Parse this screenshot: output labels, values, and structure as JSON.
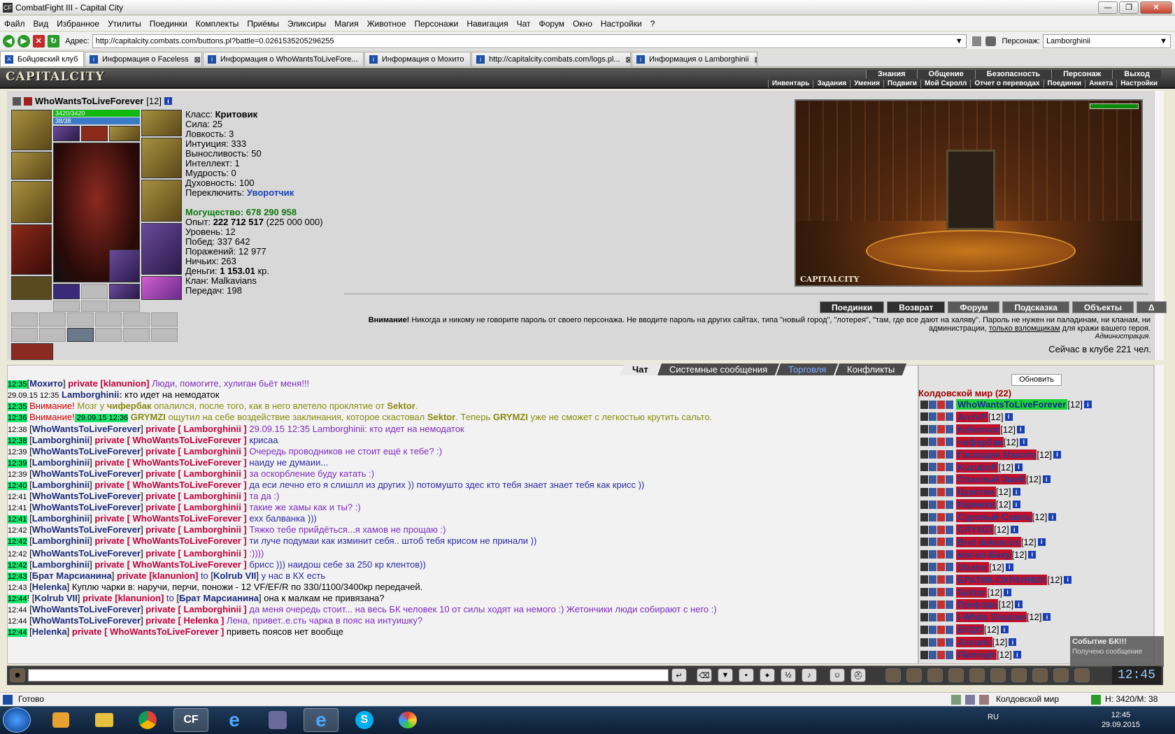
{
  "window": {
    "title": "CombatFight III - Capital City"
  },
  "menu": [
    "Файл",
    "Вид",
    "Избранное",
    "Утилиты",
    "Поединки",
    "Комплекты",
    "Приёмы",
    "Эликсиры",
    "Магия",
    "Животное",
    "Персонажи",
    "Навигация",
    "Чат",
    "Форум",
    "Окно",
    "Настройки",
    "?"
  ],
  "address": {
    "label": "Адрес:",
    "url": "http://capitalcity.combats.com/buttons.pl?battle=0.0261535205296255",
    "char_label": "Персонаж:",
    "char_value": "Lamborghinii"
  },
  "tabs": [
    {
      "label": "Бойцовский клуб"
    },
    {
      "label": "Информация о Faceless"
    },
    {
      "label": "Информация о WhoWantsToLiveFore..."
    },
    {
      "label": "Информация о Мохито"
    },
    {
      "label": "http://capitalcity.combats.com/logs.pl..."
    },
    {
      "label": "Информация о Lamborghinii"
    }
  ],
  "game": {
    "logo": "CAPITALCITY",
    "topnav": [
      "Знания",
      "Общение",
      "Безопасность",
      "Персонаж",
      "Выход"
    ],
    "subnav": [
      "Инвентарь",
      "Задания",
      "Умения",
      "Подвиги",
      "Мой Скролл",
      "Отчет о переводах",
      "Поединки",
      "Анкета",
      "Настройки"
    ]
  },
  "character": {
    "name": "WhoWantsToLiveForever",
    "level": "[12]",
    "hp": "3420/3420",
    "mana": "38/38",
    "class_label": "Класс:",
    "class_value": "Критовик",
    "stats": [
      "Сила: 25",
      "Ловкость: 3",
      "Интуиция: 333",
      "Выносливость: 50",
      "Интеллект: 1",
      "Мудрость: 0",
      "Духовность: 100"
    ],
    "switch_label": "Переключить:",
    "switch_value": "Уворотчик",
    "power_label": "Могущество:",
    "power_value": "678 290 958",
    "exp_label": "Опыт:",
    "exp_value": "222 712 517",
    "exp_next": "(225 000 000)",
    "level_line": "Уровень: 12",
    "wins": "Побед: 337 642",
    "losses": "Поражений: 12 977",
    "draws": "Ничьих: 263",
    "money_label": "Деньги:",
    "money_value": "1 153.01",
    "money_unit": "кр.",
    "clan": "Клан: Malkavians",
    "transfers": "Передач: 198"
  },
  "scene": {
    "caption": "CAPITALCITY"
  },
  "actions": [
    "Поединки",
    "Возврат",
    "Форум",
    "Подсказка",
    "Объекты",
    "Δ"
  ],
  "warning": {
    "bold": "Внимание!",
    "text": "Никогда и никому не говорите пароль от своего персонажа. Не вводите пароль на других сайтах, типа \"новый город\", \"лотерея\", \"там, где все дают на халяву\". Пароль не нужен ни паладинам, ни кланам, ни администрации,",
    "link": "только взломщикам",
    "tail": "для кражи вашего героя.",
    "sign": "Администрация."
  },
  "online": "Сейчас в клубе 221 чел.",
  "chat_tabs": [
    "Чат",
    "Системные сообщения",
    "Торговля",
    "Конфликты"
  ],
  "chat": [
    {
      "t": "12:35",
      "hl": true,
      "parts": [
        [
          "bk",
          "["
        ],
        [
          "nm",
          "Мохито"
        ],
        [
          "bk",
          "] "
        ],
        [
          "pv",
          "private [klanunion]"
        ],
        [
          "pm",
          " Люди, помогите, хулиган бьёт меня!!!"
        ]
      ]
    },
    {
      "t": "29.09.15 12:35",
      "hl": false,
      "parts": [
        [
          "nm",
          " Lamborghinii:"
        ],
        [
          "bk",
          " кто идет на немодаток"
        ]
      ]
    },
    {
      "t": "12:35",
      "hl": true,
      "parts": [
        [
          "warn",
          " Внимание!"
        ],
        [
          "sys",
          " Мозг у "
        ],
        [
          "sysb",
          "чифербак"
        ],
        [
          "sys",
          " опалился, после того, как в него влетело проклятие от "
        ],
        [
          "sysb",
          "Sektor"
        ],
        [
          "sys",
          "."
        ]
      ]
    },
    {
      "t": "12:36",
      "hl": true,
      "parts": [
        [
          "warn",
          " Внимание!"
        ],
        [
          "tsb",
          " 29.09.15 12:36"
        ],
        [
          "sysb",
          " GRYMZI"
        ],
        [
          "sys",
          " ощутил на себе воздействие заклинания, которое скастовал "
        ],
        [
          "sysb",
          "Sektor"
        ],
        [
          "sys",
          ". Теперь "
        ],
        [
          "sysb",
          "GRYMZI"
        ],
        [
          "sys",
          " уже не сможет с легкостью крутить сальто."
        ]
      ]
    },
    {
      "t": "12:38",
      "hl": false,
      "parts": [
        [
          "bk",
          " ["
        ],
        [
          "nm",
          "WhoWantsToLiveForever"
        ],
        [
          "bk",
          "] "
        ],
        [
          "pv",
          "private [ Lamborghinii ]"
        ],
        [
          "pm",
          " 29.09.15 12:35 Lamborghinii: кто идет на немодаток"
        ]
      ]
    },
    {
      "t": "12:38",
      "hl": true,
      "parts": [
        [
          "bk",
          " ["
        ],
        [
          "nm",
          "Lamborghinii"
        ],
        [
          "bk",
          "] "
        ],
        [
          "pv",
          "private [ WhoWantsToLiveForever ]"
        ],
        [
          "pm2",
          " крисаа"
        ]
      ]
    },
    {
      "t": "12:39",
      "hl": false,
      "parts": [
        [
          "bk",
          " ["
        ],
        [
          "nm",
          "WhoWantsToLiveForever"
        ],
        [
          "bk",
          "] "
        ],
        [
          "pv",
          "private [ Lamborghinii ]"
        ],
        [
          "pm",
          " Очередь проводников не стоит ещё к тебе? :)"
        ]
      ]
    },
    {
      "t": "12:39",
      "hl": true,
      "parts": [
        [
          "bk",
          " ["
        ],
        [
          "nm",
          "Lamborghinii"
        ],
        [
          "bk",
          "] "
        ],
        [
          "pv",
          "private [ WhoWantsToLiveForever ]"
        ],
        [
          "pm2",
          " наиду не думаии..."
        ]
      ]
    },
    {
      "t": "12:39",
      "hl": false,
      "parts": [
        [
          "bk",
          " ["
        ],
        [
          "nm",
          "WhoWantsToLiveForever"
        ],
        [
          "bk",
          "] "
        ],
        [
          "pv",
          "private [ Lamborghinii ]"
        ],
        [
          "pm",
          " за оскорбление буду катать :)"
        ]
      ]
    },
    {
      "t": "12:40",
      "hl": true,
      "parts": [
        [
          "bk",
          " ["
        ],
        [
          "nm",
          "Lamborghinii"
        ],
        [
          "bk",
          "] "
        ],
        [
          "pv",
          "private [ WhoWantsToLiveForever ]"
        ],
        [
          "pm2",
          " да еси лечно ето я слишлл из других )) потомушто здес кто тебя знает знает тебя как крисс ))"
        ]
      ]
    },
    {
      "t": "12:41",
      "hl": false,
      "parts": [
        [
          "bk",
          " ["
        ],
        [
          "nm",
          "WhoWantsToLiveForever"
        ],
        [
          "bk",
          "] "
        ],
        [
          "pv",
          "private [ Lamborghinii ]"
        ],
        [
          "pm",
          " та да :)"
        ]
      ]
    },
    {
      "t": "12:41",
      "hl": false,
      "parts": [
        [
          "bk",
          " ["
        ],
        [
          "nm",
          "WhoWantsToLiveForever"
        ],
        [
          "bk",
          "] "
        ],
        [
          "pv",
          "private [ Lamborghinii ]"
        ],
        [
          "pm",
          " такие же хамы как и ты? :)"
        ]
      ]
    },
    {
      "t": "12:41",
      "hl": true,
      "parts": [
        [
          "bk",
          " ["
        ],
        [
          "nm",
          "Lamborghinii"
        ],
        [
          "bk",
          "] "
        ],
        [
          "pv",
          "private [ WhoWantsToLiveForever ]"
        ],
        [
          "pm2",
          " ехх балванка )))"
        ]
      ]
    },
    {
      "t": "12:42",
      "hl": false,
      "parts": [
        [
          "bk",
          " ["
        ],
        [
          "nm",
          "WhoWantsToLiveForever"
        ],
        [
          "bk",
          "] "
        ],
        [
          "pv",
          "private [ Lamborghinii ]"
        ],
        [
          "pm",
          " Тяжко тебе прийдёться...я хамов не прощаю :)"
        ]
      ]
    },
    {
      "t": "12:42",
      "hl": true,
      "parts": [
        [
          "bk",
          " ["
        ],
        [
          "nm",
          "Lamborghinii"
        ],
        [
          "bk",
          "] "
        ],
        [
          "pv",
          "private [ WhoWantsToLiveForever ]"
        ],
        [
          "pm2",
          " ти луче подумаи как изминит себя.. штоб тебя крисом не принали ))"
        ]
      ]
    },
    {
      "t": "12:42",
      "hl": false,
      "parts": [
        [
          "bk",
          " ["
        ],
        [
          "nm",
          "WhoWantsToLiveForever"
        ],
        [
          "bk",
          "] "
        ],
        [
          "pv",
          "private [ Lamborghinii ]"
        ],
        [
          "pm",
          " :))))"
        ]
      ]
    },
    {
      "t": "12:42",
      "hl": true,
      "parts": [
        [
          "bk",
          " ["
        ],
        [
          "nm",
          "Lamborghinii"
        ],
        [
          "bk",
          "] "
        ],
        [
          "pv",
          "private [ WhoWantsToLiveForever ]"
        ],
        [
          "pm2",
          " брисс ))) наидош себе за 250 кр клентов))"
        ]
      ]
    },
    {
      "t": "12:43",
      "hl": true,
      "parts": [
        [
          "bk",
          " ["
        ],
        [
          "nm",
          "Брат Марсианина"
        ],
        [
          "bk",
          "] "
        ],
        [
          "pv",
          "private [klanunion]"
        ],
        [
          "pm2",
          " to "
        ],
        [
          "bk",
          "["
        ],
        [
          "nm",
          "Kolrub VII"
        ],
        [
          "bk",
          "]"
        ],
        [
          "pm2",
          " у нас в КХ есть"
        ]
      ]
    },
    {
      "t": "12:43",
      "hl": false,
      "parts": [
        [
          "bk",
          " ["
        ],
        [
          "nm",
          "Helenka"
        ],
        [
          "bk",
          "]"
        ],
        [
          "bk",
          " Куплю чарки в: наручи, перчи, поножи - 12 VF/EF/R по 330/1100/3400кр передачей."
        ]
      ]
    },
    {
      "t": "12:44",
      "hl": true,
      "parts": [
        [
          "bk",
          "! ["
        ],
        [
          "nm",
          "Kolrub VII"
        ],
        [
          "bk",
          "] "
        ],
        [
          "pv",
          "private [klanunion]"
        ],
        [
          "pm2",
          " to "
        ],
        [
          "bk",
          "["
        ],
        [
          "nm",
          "Брат Марсианина"
        ],
        [
          "bk",
          "]"
        ],
        [
          "bk",
          " она к малкам не привязана?"
        ]
      ]
    },
    {
      "t": "12:44",
      "hl": false,
      "parts": [
        [
          "bk",
          " ["
        ],
        [
          "nm",
          "WhoWantsToLiveForever"
        ],
        [
          "bk",
          "] "
        ],
        [
          "pv",
          "private [ Lamborghinii ]"
        ],
        [
          "pm",
          " да меня очередь стоит... на весь БК человек 10 от силы ходят на немого :) Жетончики люди собирают с него :)"
        ]
      ]
    },
    {
      "t": "12:44",
      "hl": false,
      "parts": [
        [
          "bk",
          " ["
        ],
        [
          "nm",
          "WhoWantsToLiveForever"
        ],
        [
          "bk",
          "] "
        ],
        [
          "pv",
          "private [ Helenka ]"
        ],
        [
          "pm",
          " Лена, привет..е.сть чарка в пояс на интуишку?"
        ]
      ]
    },
    {
      "t": "12:44",
      "hl": true,
      "parts": [
        [
          "bk",
          " ["
        ],
        [
          "nm",
          "Helenka"
        ],
        [
          "bk",
          "] "
        ],
        [
          "pv",
          "private [ WhoWantsToLiveForever ]"
        ],
        [
          "bk",
          " приветь поясов нет вообще"
        ]
      ]
    }
  ],
  "room": {
    "refresh": "Обновить",
    "title": "Колдовской мир (22)",
    "users": [
      {
        "name": "WhoWantsToLiveForever",
        "lvl": "[12]",
        "me": true
      },
      {
        "name": "ArchiP",
        "lvl": "[12]"
      },
      {
        "name": "Kelemvor",
        "lvl": "[12]"
      },
      {
        "name": "чифербак",
        "lvl": "[12]"
      },
      {
        "name": "Господин Макото",
        "lvl": "[12]"
      },
      {
        "name": "Kuzuboff",
        "lvl": "[12]"
      },
      {
        "name": "Опасный Змей",
        "lvl": "[12]"
      },
      {
        "name": "Цукотин",
        "lvl": "[12]"
      },
      {
        "name": "Каринка",
        "lvl": "[12]"
      },
      {
        "name": "Суровый Самец",
        "lvl": "[12]"
      },
      {
        "name": "GRYMZI",
        "lvl": "[12]"
      },
      {
        "name": "Brat dakascos",
        "lvl": "[12]"
      },
      {
        "name": "маг-из-Баку",
        "lvl": "[12]"
      },
      {
        "name": "Vizator",
        "lvl": "[12]"
      },
      {
        "name": "БРАТИК-ОХРАННИК",
        "lvl": "[12]"
      },
      {
        "name": "Sektor",
        "lvl": "[12]"
      },
      {
        "name": "Природа",
        "lvl": "[12]"
      },
      {
        "name": "I-White Shadow",
        "lvl": "[12]"
      },
      {
        "name": "БУДО",
        "lvl": "[12]"
      },
      {
        "name": "Assuric",
        "lvl": "[12]"
      },
      {
        "name": "Flamegir",
        "lvl": "[12]"
      }
    ]
  },
  "event": {
    "title": "Событие БК!!!",
    "text": "Получено сообщение"
  },
  "clock": "12:45",
  "status": {
    "ready": "Готово",
    "location": "Колдовской мир",
    "hp": "H: 3420/M: 38"
  },
  "taskbar": {
    "lang": "RU",
    "time": "12:45",
    "date": "29.09.2015"
  }
}
